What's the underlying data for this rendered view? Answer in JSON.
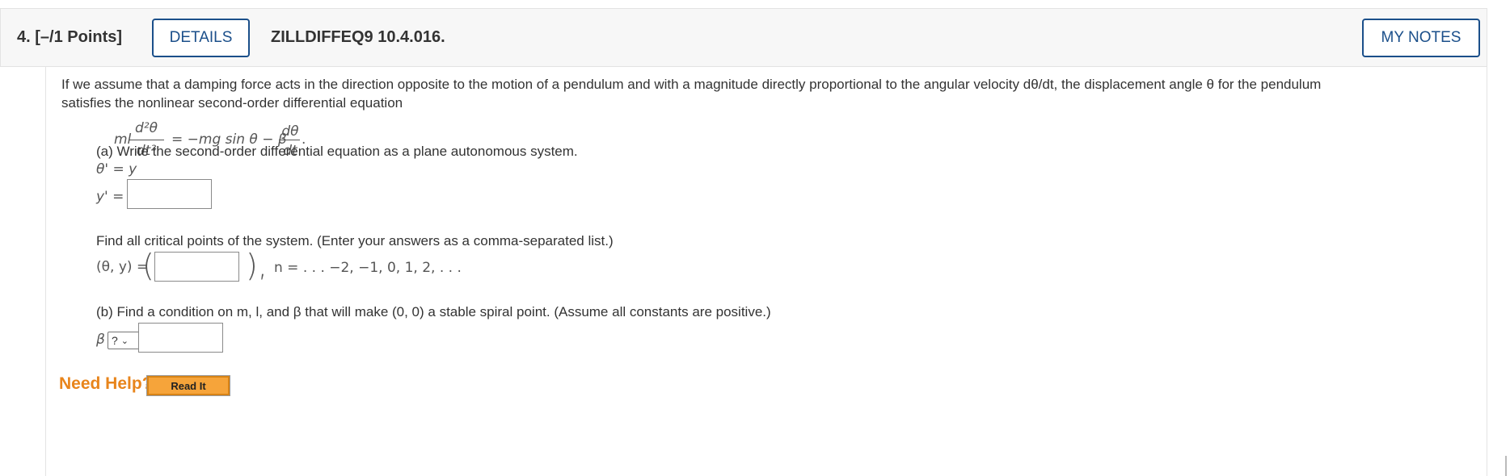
{
  "header": {
    "question_number": "4.",
    "points": "[–/1 Points]",
    "details_label": "DETAILS",
    "problem_id": "ZILLDIFFEQ9 10.4.016.",
    "my_notes_label": "MY NOTES"
  },
  "intro": {
    "line1": "If we assume that a damping force acts in the direction opposite to the motion of a pendulum and with a magnitude directly proportional to the angular velocity dθ/dt, the displacement angle θ for the pendulum",
    "line2": "satisfies the nonlinear second-order differential equation"
  },
  "equation": {
    "lhs_coeff": "ml",
    "lhs_num": "d²θ",
    "lhs_den": "dt²",
    "middle": "= −mg sin θ − β",
    "rhs_num": "dθ",
    "rhs_den": "dt",
    "end": "."
  },
  "part_a": {
    "prompt": "(a) Write the second-order differential equation as a plane autonomous system.",
    "theta_eq": "θ' = y",
    "y_label": "y' =",
    "y_value": ""
  },
  "critical": {
    "prompt": "Find all critical points of the system. (Enter your answers as a comma-separated list.)",
    "label": "(θ, y) =",
    "open_paren": "(",
    "close_paren": "),",
    "answer": "",
    "n_range": "n = . . . −2, −1, 0, 1, 2, . . ."
  },
  "part_b": {
    "prompt": "(b) Find a condition on m, l, and β that will make (0, 0) a stable spiral point. (Assume all constants are positive.)",
    "beta_label": "β",
    "select_value": "?",
    "answer": ""
  },
  "help": {
    "need_help": "Need Help?",
    "read_it": "Read It"
  }
}
